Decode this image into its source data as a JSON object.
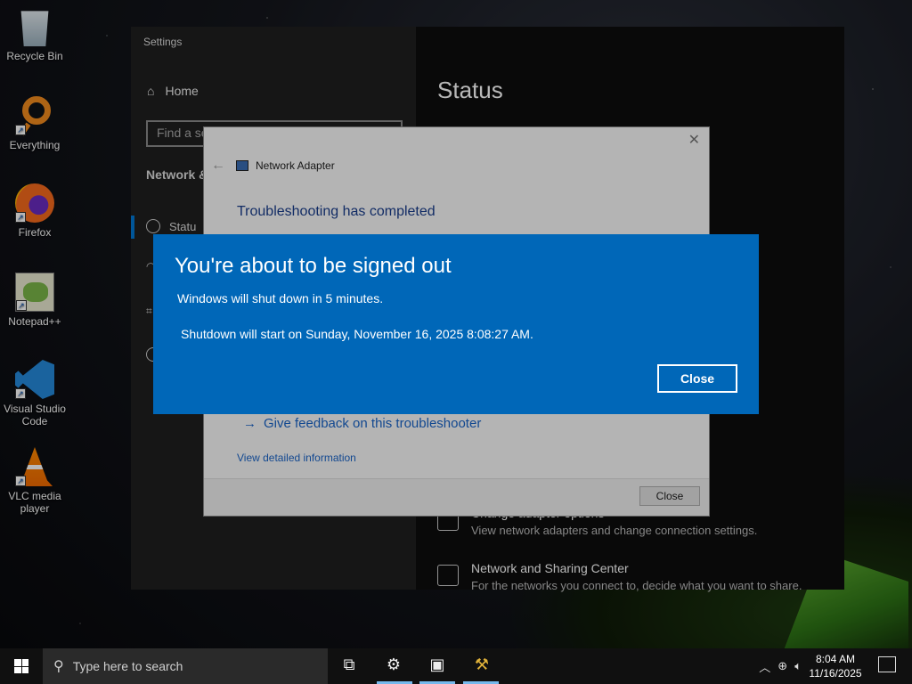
{
  "desktop": {
    "icons": [
      {
        "label": "Recycle Bin",
        "icon": "recycle-bin-icon"
      },
      {
        "label": "Everything",
        "icon": "everything-search-icon"
      },
      {
        "label": "Firefox",
        "icon": "firefox-icon"
      },
      {
        "label": "Notepad++",
        "icon": "notepad-plus-plus-icon"
      },
      {
        "label": "Visual Studio Code",
        "icon": "vscode-icon"
      },
      {
        "label": "VLC media player",
        "icon": "vlc-icon"
      }
    ]
  },
  "settings": {
    "title": "Settings",
    "home": "Home",
    "find_placeholder": "Find a se",
    "section": "Network &",
    "selected_item": "Statu",
    "pane_title": "Status",
    "items": [
      {
        "title": "Change adapter options",
        "desc": "View network adapters and change connection settings."
      },
      {
        "title": "Network and Sharing Center",
        "desc": "For the networks you connect to, decide what you want to share."
      }
    ]
  },
  "troubleshooter": {
    "header": "Network Adapter",
    "heading": "Troubleshooting has completed",
    "feedback": "Give feedback on this troubleshooter",
    "detail": "View detailed information",
    "close_label": "Close"
  },
  "signout": {
    "title": "You're about to be signed out",
    "line1": "Windows will shut down in 5 minutes.",
    "line2": "Shutdown will start on Sunday, November 16, 2025 8:08:27 AM.",
    "close_label": "Close",
    "bg_color": "#0067b8"
  },
  "taskbar": {
    "search_placeholder": "Type here to search",
    "time": "8:04 AM",
    "date": "11/16/2025"
  }
}
